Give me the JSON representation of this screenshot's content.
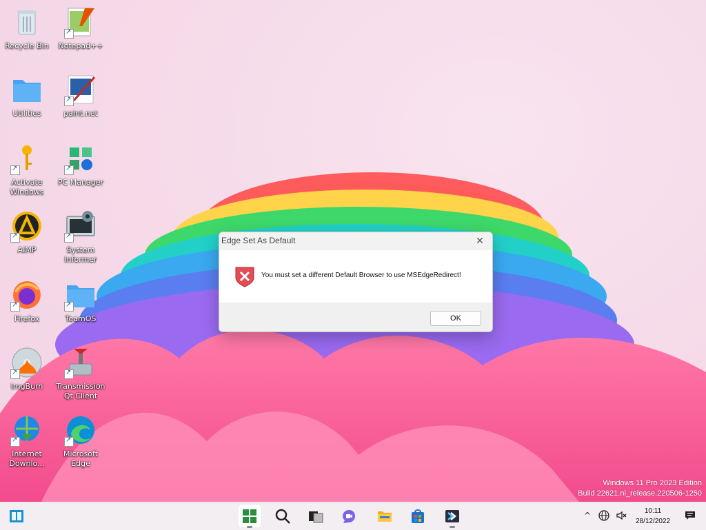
{
  "desktop": {
    "icons": [
      {
        "label": "Recycle Bin",
        "icon": "recycle-bin-icon"
      },
      {
        "label": "Notepad++",
        "icon": "notepad-plus-plus-icon"
      },
      {
        "label": "Utilities",
        "icon": "folder-icon"
      },
      {
        "label": "paint.net",
        "icon": "paint-net-icon"
      },
      {
        "label": "Activate Windows",
        "icon": "key-icon"
      },
      {
        "label": "PC Manager",
        "icon": "pc-manager-icon"
      },
      {
        "label": "AIMP",
        "icon": "aimp-icon"
      },
      {
        "label": "System Informer",
        "icon": "system-informer-icon"
      },
      {
        "label": "Firefox",
        "icon": "firefox-icon"
      },
      {
        "label": "TeamOS",
        "icon": "folder-icon"
      },
      {
        "label": "ImgBurn",
        "icon": "imgburn-icon"
      },
      {
        "label": "Transmission Qt Client",
        "icon": "transmission-icon"
      },
      {
        "label": "Internet Downlo...",
        "icon": "internet-download-manager-icon"
      },
      {
        "label": "Microsoft Edge",
        "icon": "edge-icon"
      }
    ]
  },
  "dialog": {
    "title": "Edge Set As Default",
    "close_glyph": "✕",
    "message": "You must set a different Default Browser to use MSEdgeRedirect!",
    "ok_label": "OK"
  },
  "watermark": {
    "line1": "Windows 11 Pro 2023 Edition",
    "line2": "Build 22621.ni_release.220506-1250"
  },
  "taskbar": {
    "items": [
      "widgets-icon",
      "start-icon",
      "search-icon",
      "task-view-icon",
      "chat-icon",
      "file-explorer-icon",
      "microsoft-store-icon",
      "powershell-icon"
    ],
    "tray": {
      "overflow_glyph": "^",
      "time": "10:11",
      "date": "28/12/2022"
    }
  },
  "colors": {
    "taskbar_bg": "#f3eef1",
    "dialog_footer": "#f0f0f0",
    "error_red": "#d9363e"
  }
}
